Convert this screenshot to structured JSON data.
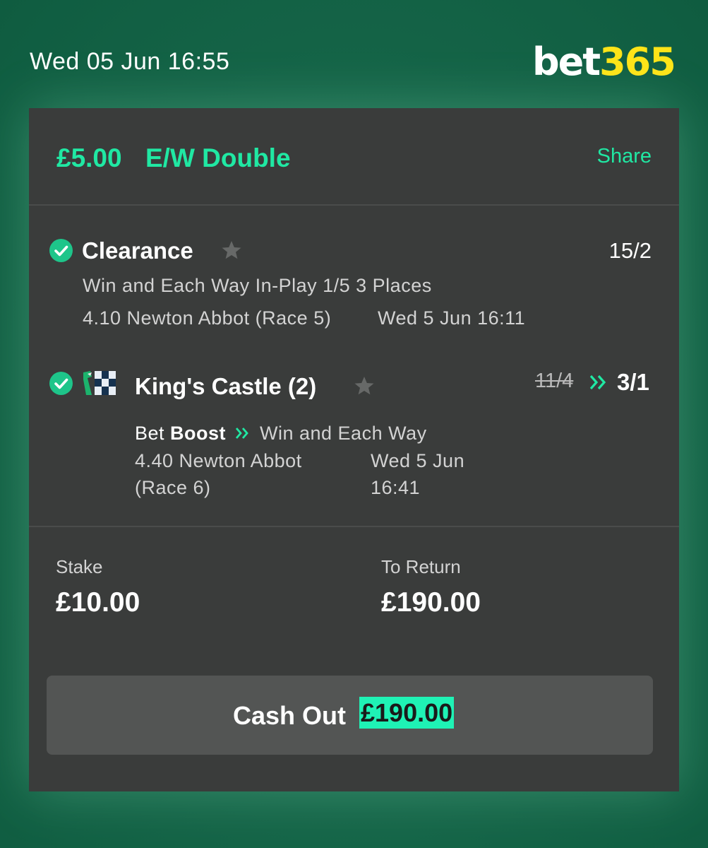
{
  "header": {
    "datetime": "Wed 05 Jun 16:55",
    "logo_part1": "bet",
    "logo_part2": "365",
    "colors": {
      "logo_white": "#ffffff",
      "logo_yellow": "#ffe418",
      "background_green": "#17674a"
    }
  },
  "bet": {
    "stake_per_way": "£5.00",
    "type": "E/W Double",
    "share_label": "Share",
    "accent_color": "#20e8a3"
  },
  "selections": [
    {
      "status_icon": "checkmark-circle-icon",
      "name": "Clearance",
      "favourite_icon": "star-icon",
      "odds": "15/2",
      "market": "Win and Each Way In-Play 1/5 3 Places",
      "event": "4.10 Newton Abbot (Race 5)",
      "start": "Wed 5 Jun 16:11"
    },
    {
      "status_icon": "checkmark-circle-icon",
      "silks_icon": "jockey-silks-icon",
      "name": "King's Castle (2)",
      "favourite_icon": "star-icon",
      "old_odds": "11/4",
      "boost_icon": "double-chevron-icon",
      "odds": "3/1",
      "boost_prefix": "Bet",
      "boost_word": "Boost",
      "market": "Win and Each Way",
      "event_line1": "4.40 Newton Abbot",
      "event_line2": "(Race 6)",
      "start_line1": "Wed 5 Jun",
      "start_line2": "16:41"
    }
  ],
  "summary": {
    "stake_label": "Stake",
    "stake_value": "£10.00",
    "return_label": "To Return",
    "return_value": "£190.00"
  },
  "cash_out": {
    "label": "Cash Out",
    "value": "£190.00",
    "highlight_color": "#1ff2b5"
  }
}
